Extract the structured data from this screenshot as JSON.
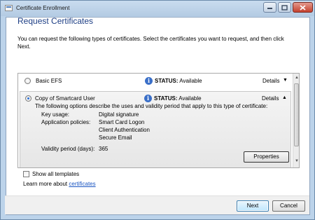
{
  "window": {
    "title": "Certificate Enrollment",
    "minimize_icon": "minimize-icon",
    "maximize_icon": "maximize-icon",
    "close_icon": "close-icon"
  },
  "main": {
    "heading": "Request Certificates",
    "intro": "You can request the following types of certificates. Select the certificates you want to request, and then click Next."
  },
  "certificates": [
    {
      "name": "Basic EFS",
      "selected": false,
      "status_label": "STATUS:",
      "status_value": "Available",
      "details_label": "Details",
      "expanded": false
    },
    {
      "name": "Copy of Smartcard User",
      "selected": true,
      "status_label": "STATUS:",
      "status_value": "Available",
      "details_label": "Details",
      "expanded": true,
      "description": "The following options describe the uses and validity period that apply to this type of certificate:",
      "key_usage_label": "Key usage:",
      "key_usage_value": "Digital signature",
      "app_policies_label": "Application policies:",
      "app_policies": [
        "Smart Card Logon",
        "Client Authentication",
        "Secure Email"
      ],
      "validity_label": "Validity period (days):",
      "validity_value": "365",
      "properties_label": "Properties"
    }
  ],
  "options": {
    "show_all_templates_label": "Show all templates",
    "show_all_checked": false,
    "learn_more_prefix": "Learn more about ",
    "learn_more_link": "certificates"
  },
  "buttons": {
    "next": "Next",
    "cancel": "Cancel"
  },
  "colors": {
    "heading": "#1e3f85",
    "link": "#1a55c2",
    "frame": "#bcd3ea"
  }
}
